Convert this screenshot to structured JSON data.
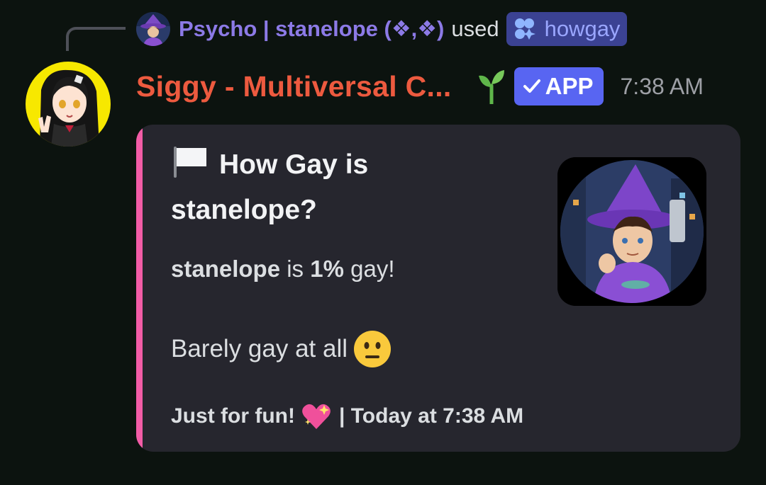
{
  "command": {
    "user": "Psycho | stanelope (❖,❖)",
    "used_text": "used",
    "command_name": "howgay"
  },
  "message": {
    "author": "Siggy - Multiversal C...",
    "app_tag": "APP",
    "time": "7:38 AM"
  },
  "embed": {
    "title": "How Gay is stanelope?",
    "target_name": "stanelope",
    "is_text": "is",
    "percent": "1%",
    "suffix": "gay!",
    "verdict": "Barely gay at all",
    "footer_text": "Just for fun!",
    "footer_sep": "| Today at 7:38 AM",
    "accent_color": "#f25ca6"
  },
  "colors": {
    "background": "#0c130f",
    "author": "#ed5a3f",
    "command_user": "#8c7ae6",
    "app_tag": "#5865f2",
    "embed_bg": "#26262e"
  },
  "icons": {
    "command": "slash-command-icon",
    "sprout": "seedling-icon",
    "check": "checkmark-icon",
    "flag": "white-flag-icon",
    "verdict_emoji": "neutral-face-icon",
    "footer_emoji": "sparkling-heart-icon"
  }
}
